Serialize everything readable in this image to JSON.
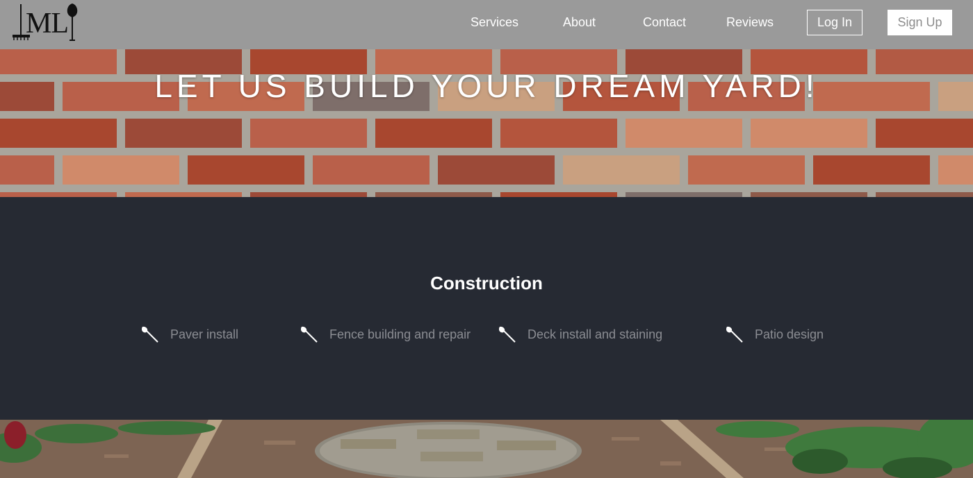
{
  "header": {
    "logo_text": "ML",
    "nav": [
      {
        "label": "Services"
      },
      {
        "label": "About"
      },
      {
        "label": "Contact"
      },
      {
        "label": "Reviews"
      }
    ],
    "login_label": "Log In",
    "signup_label": "Sign Up"
  },
  "hero": {
    "title": "LET US BUILD YOUR DREAM YARD!"
  },
  "construction": {
    "title": "Construction",
    "services": [
      {
        "label": "Paver install",
        "icon": "shovel-icon"
      },
      {
        "label": "Fence building and repair",
        "icon": "shovel-icon"
      },
      {
        "label": "Deck install and staining",
        "icon": "shovel-icon"
      },
      {
        "label": "Patio design",
        "icon": "shovel-icon"
      }
    ]
  },
  "colors": {
    "nav_bg": "#9a9a9a",
    "section_bg": "#262a33",
    "service_text": "#8b8d93",
    "brick": "#b4553d"
  }
}
